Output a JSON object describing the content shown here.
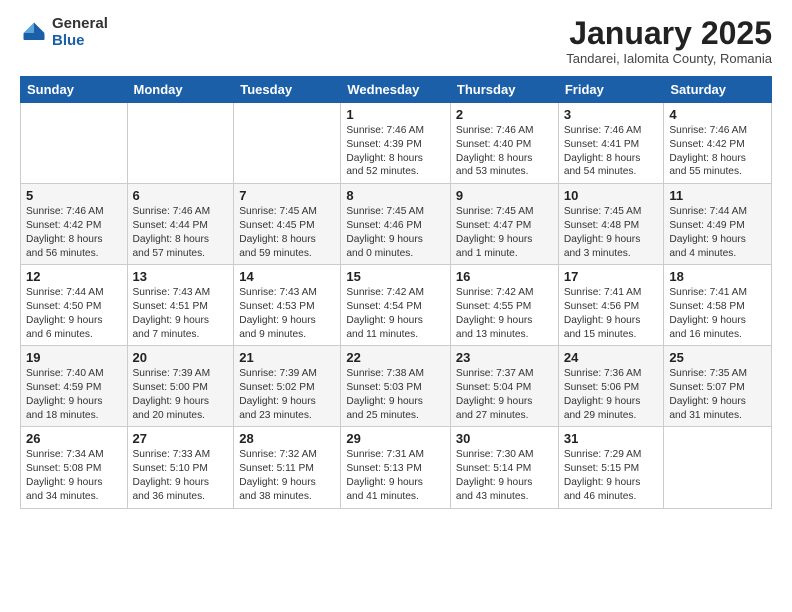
{
  "logo": {
    "general": "General",
    "blue": "Blue"
  },
  "header": {
    "month": "January 2025",
    "location": "Tandarei, Ialomita County, Romania"
  },
  "weekdays": [
    "Sunday",
    "Monday",
    "Tuesday",
    "Wednesday",
    "Thursday",
    "Friday",
    "Saturday"
  ],
  "weeks": [
    [
      {
        "day": "",
        "info": ""
      },
      {
        "day": "",
        "info": ""
      },
      {
        "day": "",
        "info": ""
      },
      {
        "day": "1",
        "info": "Sunrise: 7:46 AM\nSunset: 4:39 PM\nDaylight: 8 hours\nand 52 minutes."
      },
      {
        "day": "2",
        "info": "Sunrise: 7:46 AM\nSunset: 4:40 PM\nDaylight: 8 hours\nand 53 minutes."
      },
      {
        "day": "3",
        "info": "Sunrise: 7:46 AM\nSunset: 4:41 PM\nDaylight: 8 hours\nand 54 minutes."
      },
      {
        "day": "4",
        "info": "Sunrise: 7:46 AM\nSunset: 4:42 PM\nDaylight: 8 hours\nand 55 minutes."
      }
    ],
    [
      {
        "day": "5",
        "info": "Sunrise: 7:46 AM\nSunset: 4:42 PM\nDaylight: 8 hours\nand 56 minutes."
      },
      {
        "day": "6",
        "info": "Sunrise: 7:46 AM\nSunset: 4:44 PM\nDaylight: 8 hours\nand 57 minutes."
      },
      {
        "day": "7",
        "info": "Sunrise: 7:45 AM\nSunset: 4:45 PM\nDaylight: 8 hours\nand 59 minutes."
      },
      {
        "day": "8",
        "info": "Sunrise: 7:45 AM\nSunset: 4:46 PM\nDaylight: 9 hours\nand 0 minutes."
      },
      {
        "day": "9",
        "info": "Sunrise: 7:45 AM\nSunset: 4:47 PM\nDaylight: 9 hours\nand 1 minute."
      },
      {
        "day": "10",
        "info": "Sunrise: 7:45 AM\nSunset: 4:48 PM\nDaylight: 9 hours\nand 3 minutes."
      },
      {
        "day": "11",
        "info": "Sunrise: 7:44 AM\nSunset: 4:49 PM\nDaylight: 9 hours\nand 4 minutes."
      }
    ],
    [
      {
        "day": "12",
        "info": "Sunrise: 7:44 AM\nSunset: 4:50 PM\nDaylight: 9 hours\nand 6 minutes."
      },
      {
        "day": "13",
        "info": "Sunrise: 7:43 AM\nSunset: 4:51 PM\nDaylight: 9 hours\nand 7 minutes."
      },
      {
        "day": "14",
        "info": "Sunrise: 7:43 AM\nSunset: 4:53 PM\nDaylight: 9 hours\nand 9 minutes."
      },
      {
        "day": "15",
        "info": "Sunrise: 7:42 AM\nSunset: 4:54 PM\nDaylight: 9 hours\nand 11 minutes."
      },
      {
        "day": "16",
        "info": "Sunrise: 7:42 AM\nSunset: 4:55 PM\nDaylight: 9 hours\nand 13 minutes."
      },
      {
        "day": "17",
        "info": "Sunrise: 7:41 AM\nSunset: 4:56 PM\nDaylight: 9 hours\nand 15 minutes."
      },
      {
        "day": "18",
        "info": "Sunrise: 7:41 AM\nSunset: 4:58 PM\nDaylight: 9 hours\nand 16 minutes."
      }
    ],
    [
      {
        "day": "19",
        "info": "Sunrise: 7:40 AM\nSunset: 4:59 PM\nDaylight: 9 hours\nand 18 minutes."
      },
      {
        "day": "20",
        "info": "Sunrise: 7:39 AM\nSunset: 5:00 PM\nDaylight: 9 hours\nand 20 minutes."
      },
      {
        "day": "21",
        "info": "Sunrise: 7:39 AM\nSunset: 5:02 PM\nDaylight: 9 hours\nand 23 minutes."
      },
      {
        "day": "22",
        "info": "Sunrise: 7:38 AM\nSunset: 5:03 PM\nDaylight: 9 hours\nand 25 minutes."
      },
      {
        "day": "23",
        "info": "Sunrise: 7:37 AM\nSunset: 5:04 PM\nDaylight: 9 hours\nand 27 minutes."
      },
      {
        "day": "24",
        "info": "Sunrise: 7:36 AM\nSunset: 5:06 PM\nDaylight: 9 hours\nand 29 minutes."
      },
      {
        "day": "25",
        "info": "Sunrise: 7:35 AM\nSunset: 5:07 PM\nDaylight: 9 hours\nand 31 minutes."
      }
    ],
    [
      {
        "day": "26",
        "info": "Sunrise: 7:34 AM\nSunset: 5:08 PM\nDaylight: 9 hours\nand 34 minutes."
      },
      {
        "day": "27",
        "info": "Sunrise: 7:33 AM\nSunset: 5:10 PM\nDaylight: 9 hours\nand 36 minutes."
      },
      {
        "day": "28",
        "info": "Sunrise: 7:32 AM\nSunset: 5:11 PM\nDaylight: 9 hours\nand 38 minutes."
      },
      {
        "day": "29",
        "info": "Sunrise: 7:31 AM\nSunset: 5:13 PM\nDaylight: 9 hours\nand 41 minutes."
      },
      {
        "day": "30",
        "info": "Sunrise: 7:30 AM\nSunset: 5:14 PM\nDaylight: 9 hours\nand 43 minutes."
      },
      {
        "day": "31",
        "info": "Sunrise: 7:29 AM\nSunset: 5:15 PM\nDaylight: 9 hours\nand 46 minutes."
      },
      {
        "day": "",
        "info": ""
      }
    ]
  ]
}
